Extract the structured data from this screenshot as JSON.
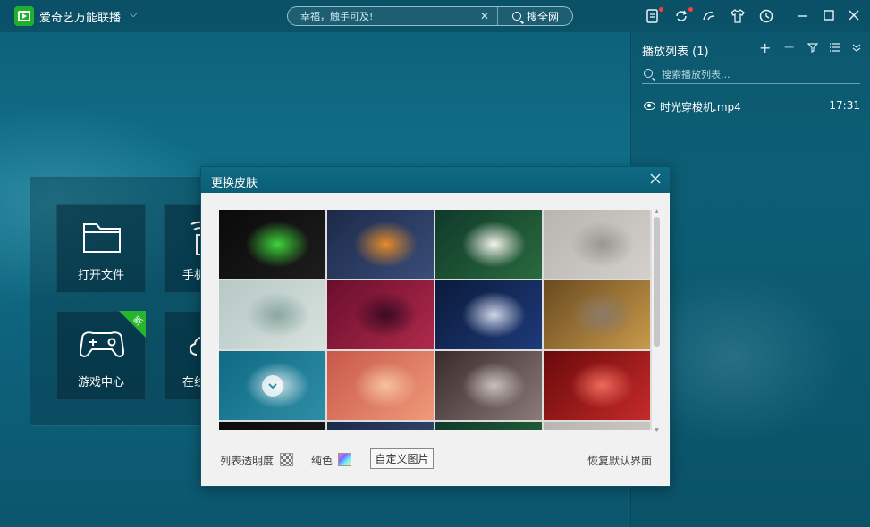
{
  "app": {
    "title": "爱奇艺万能联播",
    "dropdown_icon": "chevron-down-icon"
  },
  "search": {
    "placeholder": "幸福，触手可及!",
    "button_label": "搜全网"
  },
  "toolbar_icons": [
    "notes-icon",
    "refresh-sync-icon",
    "share-icon",
    "skin-shirt-icon",
    "history-clock-icon"
  ],
  "window_controls": [
    "minimize-icon",
    "maximize-icon",
    "close-icon"
  ],
  "playlist": {
    "title": "播放列表 (1)",
    "search_placeholder": "搜索播放列表...",
    "items": [
      {
        "name": "时光穿梭机.mp4",
        "duration": "17:31"
      }
    ]
  },
  "home": {
    "tiles": [
      {
        "label": "打开文件",
        "icon": "folder-icon"
      },
      {
        "label": "手机",
        "icon": "phone-wifi-icon"
      },
      {
        "label": "游戏中心",
        "icon": "gamepad-icon",
        "badge": "新"
      },
      {
        "label": "在线",
        "icon": "cloud-icon"
      }
    ]
  },
  "skin_dialog": {
    "title": "更换皮肤",
    "thumbnails": [
      {
        "name": "green-logo",
        "colors": [
          "#0a0a0a",
          "#1d1d1d",
          "#3fd43a"
        ]
      },
      {
        "name": "cartoon-rabbit",
        "colors": [
          "#1c2a4a",
          "#3a4d78",
          "#e58a2a"
        ]
      },
      {
        "name": "lotus",
        "colors": [
          "#0f3a2a",
          "#2a6a3e",
          "#f3f3ea"
        ]
      },
      {
        "name": "grey-geometric",
        "colors": [
          "#b8b5b1",
          "#d3d0cc",
          "#9a9793"
        ]
      },
      {
        "name": "umbrella",
        "colors": [
          "#b6c8c5",
          "#d8e2de",
          "#8aa79f"
        ]
      },
      {
        "name": "red-abstract",
        "colors": [
          "#6a0e2e",
          "#b02a4a",
          "#3a0a22"
        ]
      },
      {
        "name": "starry-night",
        "colors": [
          "#0a1a3a",
          "#1e3a7a",
          "#cfd6e8"
        ]
      },
      {
        "name": "wheat-field",
        "colors": [
          "#6a4a20",
          "#c89a4a",
          "#8a7a6a"
        ]
      },
      {
        "name": "water-drops",
        "colors": [
          "#0f6a84",
          "#2e8ea6",
          "#cfe3ea"
        ]
      },
      {
        "name": "pink-clouds",
        "colors": [
          "#c8584a",
          "#f09a7a",
          "#f6c2a0"
        ]
      },
      {
        "name": "feather",
        "colors": [
          "#3a2a2a",
          "#8a7a7a",
          "#c8c0bd"
        ]
      },
      {
        "name": "red-drops",
        "colors": [
          "#6a0a0a",
          "#c62a2a",
          "#ee6a5a"
        ]
      }
    ],
    "selected_index": 8,
    "footer": {
      "transparency_label": "列表透明度",
      "solid_color_label": "纯色",
      "custom_image_label": "自定义图片",
      "reset_label": "恢复默认界面"
    }
  }
}
